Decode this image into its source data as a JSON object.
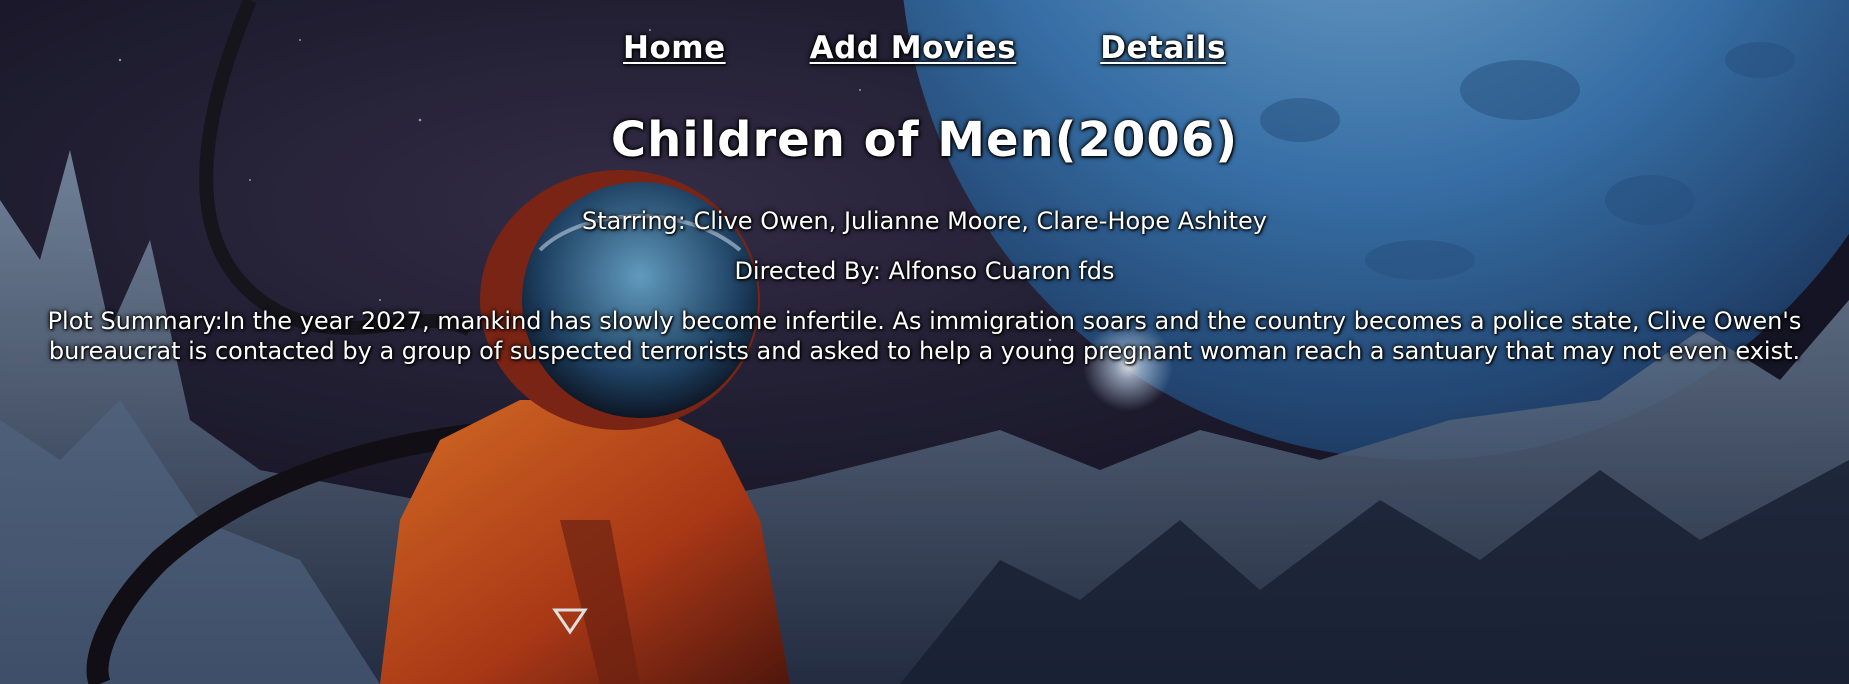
{
  "nav": {
    "home": "Home",
    "add_movies": "Add Movies",
    "details": "Details"
  },
  "movie": {
    "title": "Children of Men(2006)",
    "starring": "Starring: Clive Owen, Julianne Moore, Clare-Hope Ashitey",
    "directed_by": "Directed By: Alfonso Cuaron fds",
    "plot": "Plot Summary:In the year 2027, mankind has slowly become infertile. As immigration soars and the country becomes a police state, Clive Owen's bureaucrat is contacted by a group of suspected terrorists and asked to help a young pregnant woman reach a santuary that may not even exist."
  },
  "colors": {
    "text": "#ffffff",
    "space_dark": "#1c1a2e",
    "planet_blue": "#4f8fc8",
    "suit_orange": "#e0561e",
    "ice": "#b8cde0"
  },
  "background": {
    "icon": "astronaut-planet-illustration"
  }
}
